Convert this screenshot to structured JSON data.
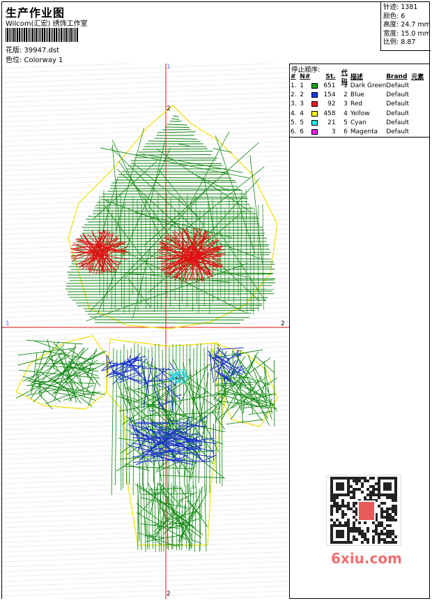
{
  "header": {
    "title": "生产作业图",
    "company": "Wilcom(汇宏) 绣饰工作室",
    "design_label": "花版: 39947.dst",
    "colorway_label": "色位: Colorway 1"
  },
  "specs": [
    {
      "label": "针迹:",
      "value": "1381"
    },
    {
      "label": "颜色:",
      "value": "6"
    },
    {
      "label": "高度:",
      "value": "24.7 mm"
    },
    {
      "label": "宽度:",
      "value": "15.0 mm"
    },
    {
      "label": "比例:",
      "value": "8.87"
    }
  ],
  "stop_sequence": {
    "title": "停止顺序:",
    "columns": [
      "#",
      "N#",
      "St.",
      "代码",
      "描述",
      "Brand",
      "元素"
    ],
    "rows": [
      {
        "num": "1.",
        "n": "1",
        "color": "#1aa01a",
        "stitches": "651",
        "code": "1",
        "desc": "Dark Green",
        "brand": "Default"
      },
      {
        "num": "2.",
        "n": "2",
        "color": "#1c38e0",
        "stitches": "154",
        "code": "2",
        "desc": "Blue",
        "brand": "Default"
      },
      {
        "num": "3.",
        "n": "3",
        "color": "#e81c1c",
        "stitches": "92",
        "code": "3",
        "desc": "Red",
        "brand": "Default"
      },
      {
        "num": "4.",
        "n": "4",
        "color": "#f5f51c",
        "stitches": "458",
        "code": "4",
        "desc": "Yellow",
        "brand": "Default"
      },
      {
        "num": "5.",
        "n": "5",
        "color": "#1ce8e8",
        "stitches": "21",
        "code": "5",
        "desc": "Cyan",
        "brand": "Default"
      },
      {
        "num": "6.",
        "n": "6",
        "color": "#e81ce8",
        "stitches": "3",
        "code": "6",
        "desc": "Magenta",
        "brand": "Default"
      }
    ]
  },
  "axis_labels": {
    "top": "1",
    "left": "1",
    "right": "2",
    "bottom": "2",
    "top2": "2"
  },
  "watermark": "6xiu.com",
  "colors": {
    "crosshair": "#e01010",
    "outline": "#f0e000",
    "green": "#108810",
    "blue": "#1a2fd0",
    "red": "#e01010",
    "cyan": "#20d8e8"
  }
}
